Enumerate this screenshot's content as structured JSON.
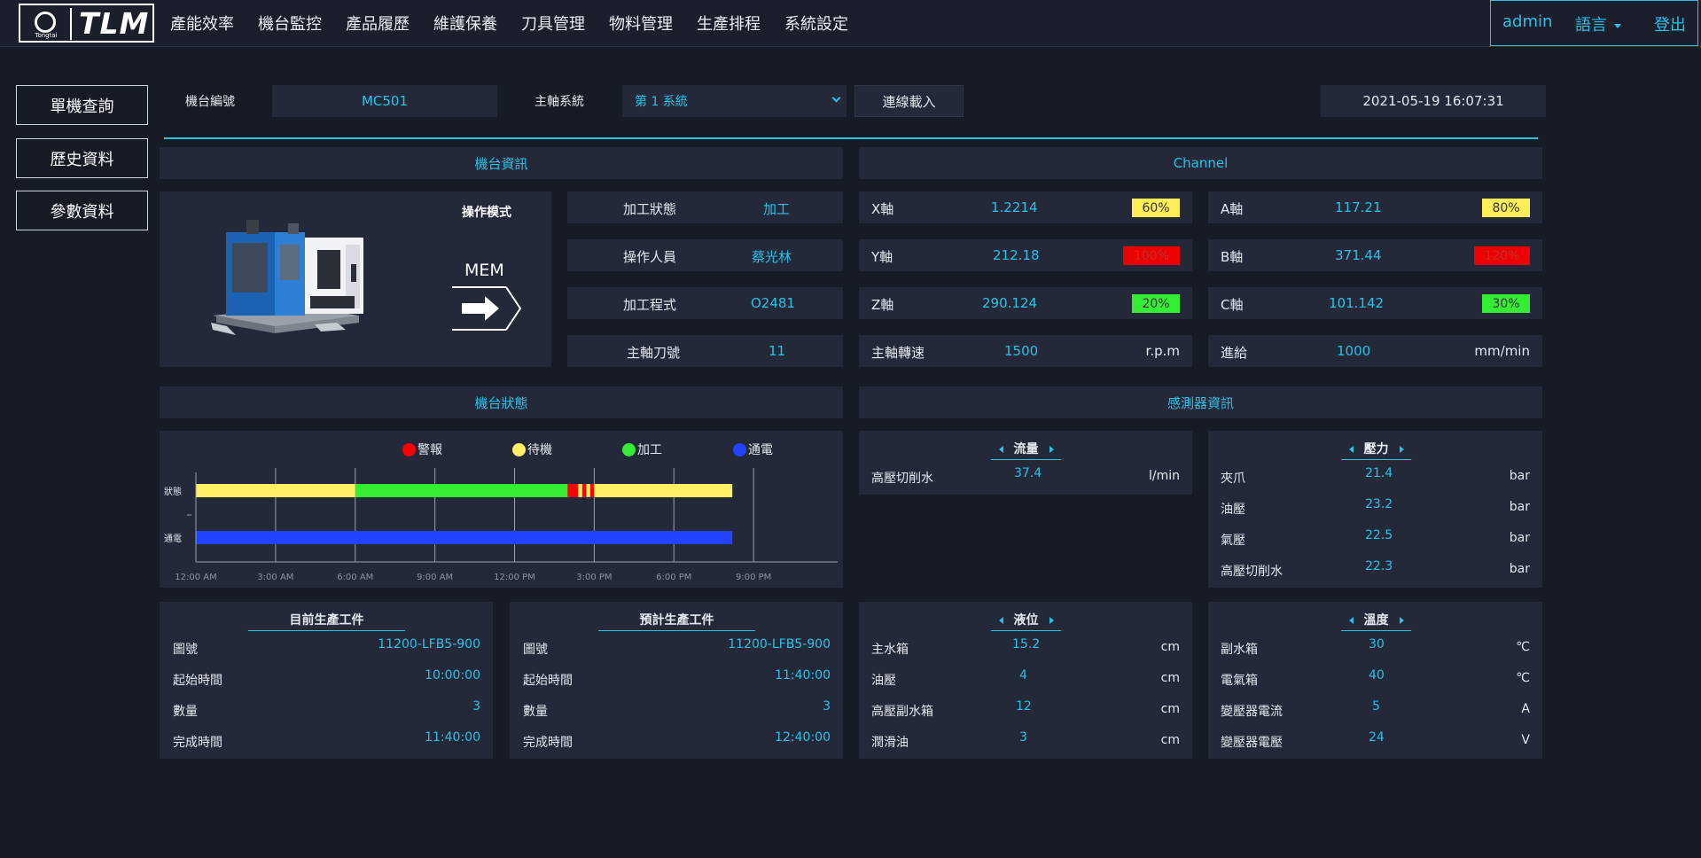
{
  "logo": {
    "text": "TLM",
    "brand": "Tongtai"
  },
  "nav": [
    "產能效率",
    "機台監控",
    "產品履歷",
    "維護保養",
    "刀具管理",
    "物料管理",
    "生產排程",
    "系統設定"
  ],
  "user": {
    "name": "admin",
    "language": "語言",
    "logout": "登出"
  },
  "sidebar": [
    "單機查詢",
    "歷史資料",
    "參數資料"
  ],
  "toolbar": {
    "machine_label": "機台編號",
    "machine_id": "MC501",
    "spindle_label": "主軸系統",
    "spindle_value": "第 1 系統",
    "connect_button": "連線載入",
    "datetime": "2021-05-19 16:07:31"
  },
  "machine_info": {
    "title": "機台資訊",
    "mode_label": "操作模式",
    "mode_value": "MEM",
    "rows": [
      {
        "label": "加工狀態",
        "value": "加工"
      },
      {
        "label": "操作人員",
        "value": "蔡光林"
      },
      {
        "label": "加工程式",
        "value": "O2481"
      },
      {
        "label": "主軸刀號",
        "value": "11"
      }
    ]
  },
  "channel": {
    "title": "Channel",
    "axes": [
      {
        "label": "X軸",
        "value": "1.2214",
        "load": "60%"
      },
      {
        "label": "Y軸",
        "value": "212.18",
        "load": "100%"
      },
      {
        "label": "Z軸",
        "value": "290.124",
        "load": "20%"
      },
      {
        "label": "A軸",
        "value": "117.21",
        "load": "80%"
      },
      {
        "label": "B軸",
        "value": "371.44",
        "load": "120%"
      },
      {
        "label": "C軸",
        "value": "101.142",
        "load": "30%"
      }
    ],
    "spindle": {
      "label": "主軸轉速",
      "value": "1500",
      "unit": "r.p.m"
    },
    "feed": {
      "label": "進給",
      "value": "1000",
      "unit": "mm/min"
    }
  },
  "machine_status": {
    "title": "機台狀態",
    "legend": [
      {
        "label": "警報",
        "color": "#ff0000"
      },
      {
        "label": "待機",
        "color": "#ffee66"
      },
      {
        "label": "加工",
        "color": "#33ee33"
      },
      {
        "label": "通電",
        "color": "#2244ff"
      }
    ],
    "row_labels": [
      "狀態",
      "通電"
    ],
    "ticks": [
      "12:00 AM",
      "3:00 AM",
      "6:00 AM",
      "9:00 AM",
      "12:00 PM",
      "3:00 PM",
      "6:00 PM",
      "9:00 PM"
    ]
  },
  "chart_data": {
    "type": "table",
    "x_range_hours": [
      0,
      24
    ],
    "ticks": [
      "12:00 AM",
      "3:00 AM",
      "6:00 AM",
      "9:00 AM",
      "12:00 PM",
      "3:00 PM",
      "6:00 PM",
      "9:00 PM"
    ],
    "rows": [
      {
        "label": "狀態",
        "segments": [
          {
            "start": 0,
            "end": 6,
            "state": "待機"
          },
          {
            "start": 6,
            "end": 14,
            "state": "加工"
          },
          {
            "start": 14,
            "end": 14.4,
            "state": "警報"
          },
          {
            "start": 14.4,
            "end": 14.55,
            "state": "待機"
          },
          {
            "start": 14.55,
            "end": 14.7,
            "state": "警報"
          },
          {
            "start": 14.7,
            "end": 14.85,
            "state": "待機"
          },
          {
            "start": 14.85,
            "end": 15,
            "state": "警報"
          },
          {
            "start": 15,
            "end": 20.2,
            "state": "待機"
          }
        ]
      },
      {
        "label": "通電",
        "segments": [
          {
            "start": 0,
            "end": 20.2,
            "state": "通電"
          }
        ]
      }
    ]
  },
  "sensor": {
    "title": "感測器資訊",
    "flow": {
      "title": "流量",
      "rows": [
        {
          "label": "高壓切削水",
          "value": "37.4",
          "unit": "l/min"
        }
      ]
    },
    "pressure": {
      "title": "壓力",
      "rows": [
        {
          "label": "夾爪",
          "value": "21.4",
          "unit": "bar"
        },
        {
          "label": "油壓",
          "value": "23.2",
          "unit": "bar"
        },
        {
          "label": "氣壓",
          "value": "22.5",
          "unit": "bar"
        },
        {
          "label": "高壓切削水",
          "value": "22.3",
          "unit": "bar"
        }
      ]
    },
    "level": {
      "title": "液位",
      "rows": [
        {
          "label": "主水箱",
          "value": "15.2",
          "unit": "cm"
        },
        {
          "label": "油壓",
          "value": "4",
          "unit": "cm"
        },
        {
          "label": "高壓副水箱",
          "value": "12",
          "unit": "cm"
        },
        {
          "label": "潤滑油",
          "value": "3",
          "unit": "cm"
        }
      ]
    },
    "temperature": {
      "title": "溫度",
      "rows": [
        {
          "label": "副水箱",
          "value": "30",
          "unit": "℃"
        },
        {
          "label": "電氣箱",
          "value": "40",
          "unit": "℃"
        },
        {
          "label": "變壓器電流",
          "value": "5",
          "unit": "A"
        },
        {
          "label": "變壓器電壓",
          "value": "24",
          "unit": "V"
        }
      ]
    }
  },
  "current_job": {
    "title": "目前生產工件",
    "rows": [
      {
        "label": "圖號",
        "value": "11200-LFB5-900"
      },
      {
        "label": "起始時間",
        "value": "10:00:00"
      },
      {
        "label": "數量",
        "value": "3"
      },
      {
        "label": "完成時間",
        "value": "11:40:00"
      }
    ]
  },
  "next_job": {
    "title": "預計生產工件",
    "rows": [
      {
        "label": "圖號",
        "value": "11200-LFB5-900"
      },
      {
        "label": "起始時間",
        "value": "11:40:00"
      },
      {
        "label": "數量",
        "value": "3"
      },
      {
        "label": "完成時間",
        "value": "12:40:00"
      }
    ]
  },
  "colors": {
    "accent": "#27c3ea",
    "panel": "#232938",
    "background": "#161b26",
    "load_yellow": "#ffee55",
    "load_red": "#ee0000",
    "load_green": "#33ee33"
  }
}
